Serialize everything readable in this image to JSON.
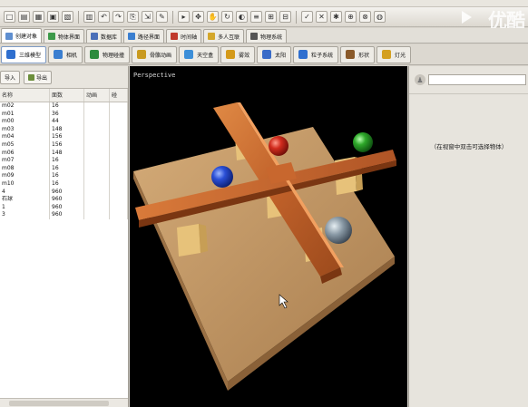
{
  "toolbar": {
    "buttons": [
      "□",
      "▤",
      "▦",
      "▣",
      "▧",
      "▥",
      "↶",
      "↷",
      "⎘",
      "⇲",
      "✎",
      "▸",
      "✥",
      "✋",
      "↻",
      "◐",
      "≡",
      "⊞",
      "⊟",
      "✓",
      "✕",
      "✱",
      "⊕",
      "⊗",
      "◍"
    ]
  },
  "watermark": "优酷",
  "tabs1": [
    {
      "label": "创建对象",
      "color": "#5f8fd0",
      "active": true
    },
    {
      "label": "物体界面",
      "color": "#3d9a4a"
    },
    {
      "label": "数据库",
      "color": "#4a6fb8"
    },
    {
      "label": "路径界面",
      "color": "#3a7fd0"
    },
    {
      "label": "时间轴",
      "color": "#c0392b"
    },
    {
      "label": "多人互联",
      "color": "#d4a72a"
    },
    {
      "label": "物理系统",
      "color": "#555555"
    }
  ],
  "tabs2": [
    {
      "label": "三维模型",
      "color": "#2f6fcf",
      "active": true
    },
    {
      "label": "相机",
      "color": "#3b7fd0"
    },
    {
      "label": "物理碰撞",
      "color": "#2e8b3d"
    },
    {
      "label": "骨骼动画",
      "color": "#c99a20"
    },
    {
      "label": "天空盒",
      "color": "#3d8fd8"
    },
    {
      "label": "雾效",
      "color": "#d49a1a"
    },
    {
      "label": "太阳",
      "color": "#3a6cc8"
    },
    {
      "label": "粒子系统",
      "color": "#2f6fcf"
    },
    {
      "label": "形状",
      "color": "#8a5a2a"
    },
    {
      "label": "灯光",
      "color": "#d4a020"
    }
  ],
  "left_panel": {
    "import_label": "导入",
    "export_label": "导出",
    "columns": [
      "名称",
      "面数",
      "动画",
      "碰"
    ],
    "rows": [
      [
        "m02",
        "16",
        "",
        ""
      ],
      [
        "m01",
        "36",
        "",
        ""
      ],
      [
        "m00",
        "44",
        "",
        ""
      ],
      [
        "m03",
        "148",
        "",
        ""
      ],
      [
        "m04",
        "156",
        "",
        ""
      ],
      [
        "m05",
        "156",
        "",
        ""
      ],
      [
        "m06",
        "148",
        "",
        ""
      ],
      [
        "m07",
        "16",
        "",
        ""
      ],
      [
        "m08",
        "16",
        "",
        ""
      ],
      [
        "m09",
        "16",
        "",
        ""
      ],
      [
        "m10",
        "16",
        "",
        ""
      ],
      [
        "4",
        "960",
        "",
        ""
      ],
      [
        "石球",
        "960",
        "",
        ""
      ],
      [
        "1",
        "960",
        "",
        ""
      ],
      [
        "3",
        "960",
        "",
        ""
      ]
    ]
  },
  "viewport": {
    "label": "Perspective"
  },
  "right_panel": {
    "hint": "（在视窗中双击可选择物体）"
  }
}
